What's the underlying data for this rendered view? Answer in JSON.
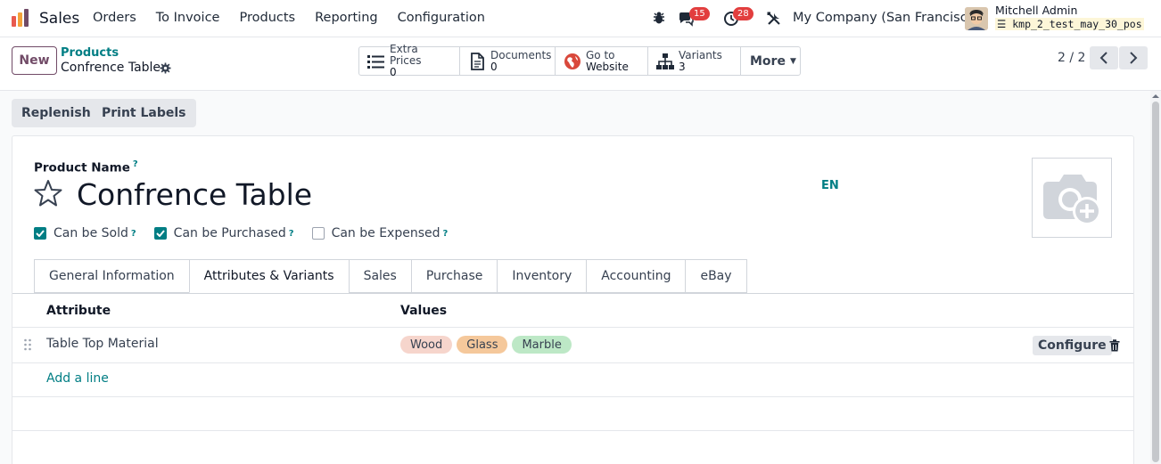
{
  "app": {
    "name": "Sales"
  },
  "menu": [
    "Orders",
    "To Invoice",
    "Products",
    "Reporting",
    "Configuration"
  ],
  "systray": {
    "messages_count": "15",
    "activities_count": "28",
    "company": "My Company (San Francisco)",
    "user_name": "Mitchell Admin",
    "database": "kmp_2_test_may_30_pos"
  },
  "control": {
    "new_label": "New",
    "breadcrumb_parent": "Products",
    "breadcrumb_current": "Confrence Table",
    "smart_buttons": [
      {
        "label": "Extra Prices",
        "value": "0",
        "icon": "list-icon"
      },
      {
        "label": "Documents",
        "value": "0",
        "icon": "file-icon"
      },
      {
        "label": "Go to",
        "value": "Website",
        "icon": "globe-icon"
      },
      {
        "label": "Variants",
        "value": "3",
        "icon": "sitemap-icon"
      }
    ],
    "more_label": "More",
    "pager": "2 / 2"
  },
  "actions": {
    "replenish": "Replenish",
    "print_labels": "Print Labels"
  },
  "form": {
    "product_name_label": "Product Name",
    "help_mark": "?",
    "product_name": "Confrence Table",
    "lang": "EN",
    "checkboxes": [
      {
        "label": "Can be Sold",
        "checked": true
      },
      {
        "label": "Can be Purchased",
        "checked": true
      },
      {
        "label": "Can be Expensed",
        "checked": false
      }
    ],
    "tabs": [
      "General Information",
      "Attributes & Variants",
      "Sales",
      "Purchase",
      "Inventory",
      "Accounting",
      "eBay"
    ],
    "active_tab": "Attributes & Variants"
  },
  "table": {
    "headers": {
      "attribute": "Attribute",
      "values": "Values"
    },
    "rows": [
      {
        "attribute": "Table Top Material",
        "values": [
          {
            "label": "Wood",
            "color": "#f6d5cc"
          },
          {
            "label": "Glass",
            "color": "#f5c89b"
          },
          {
            "label": "Marble",
            "color": "#bde8c6"
          }
        ]
      }
    ],
    "configure_label": "Configure",
    "add_line": "Add a line"
  },
  "colors": {
    "brand": "#714b67",
    "accent": "#017e84",
    "badge": "#e23e3e"
  }
}
